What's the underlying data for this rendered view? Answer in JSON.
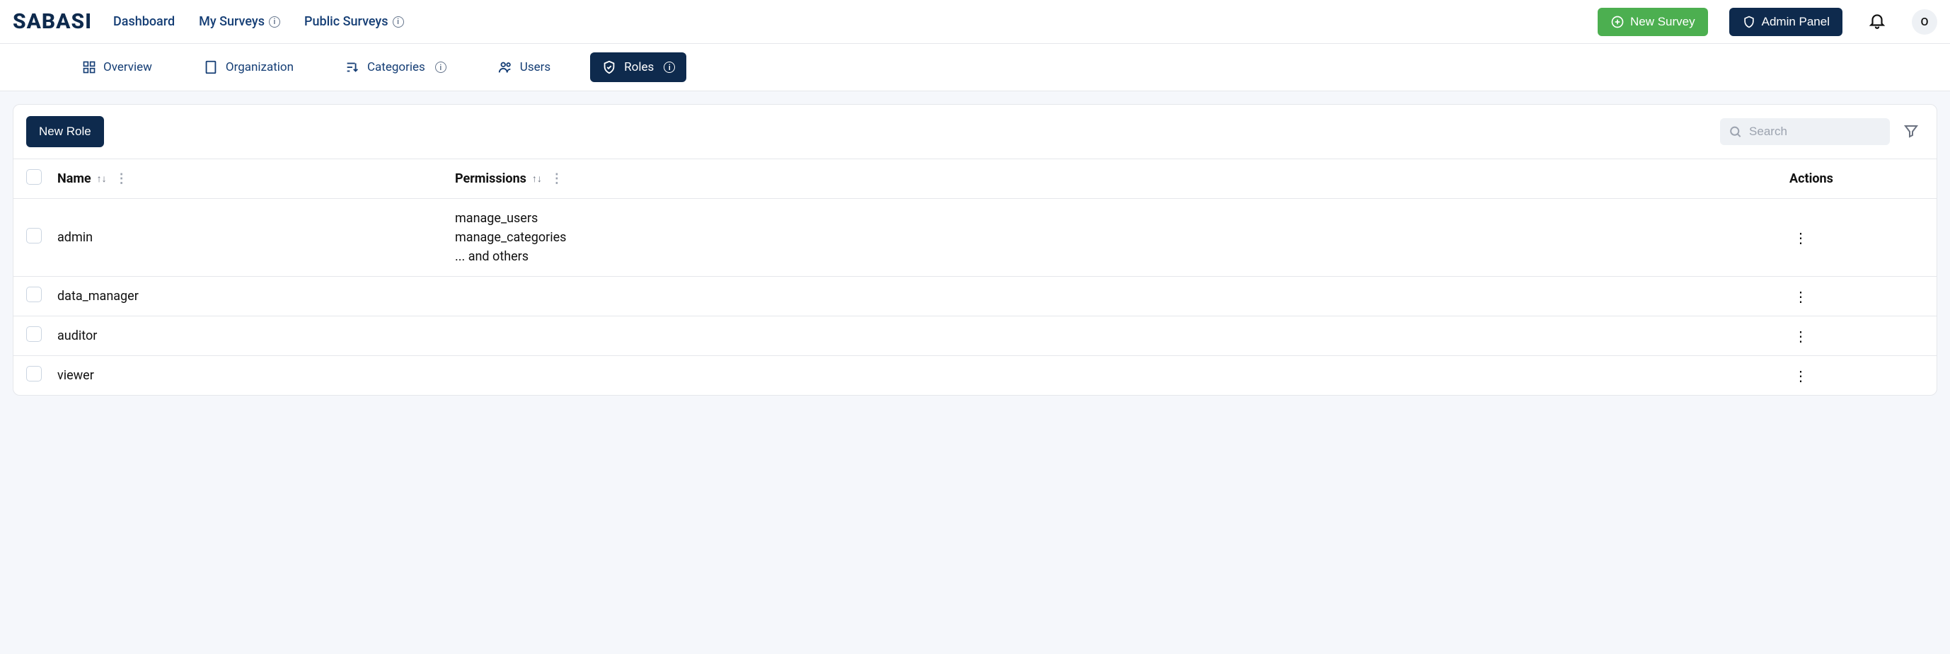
{
  "brand": "SABASI",
  "nav": {
    "dashboard": "Dashboard",
    "my_surveys": "My Surveys",
    "public_surveys": "Public Surveys"
  },
  "actions": {
    "new_survey": "New Survey",
    "admin_panel": "Admin Panel"
  },
  "avatar_initial": "O",
  "subtabs": {
    "overview": "Overview",
    "organization": "Organization",
    "categories": "Categories",
    "users": "Users",
    "roles": "Roles"
  },
  "panel": {
    "new_role": "New Role",
    "search_placeholder": "Search"
  },
  "table": {
    "headers": {
      "name": "Name",
      "permissions": "Permissions",
      "actions": "Actions"
    },
    "rows": [
      {
        "name": "admin",
        "permissions": [
          "manage_users",
          "manage_categories",
          "... and others"
        ]
      },
      {
        "name": "data_manager",
        "permissions": []
      },
      {
        "name": "auditor",
        "permissions": []
      },
      {
        "name": "viewer",
        "permissions": []
      }
    ]
  }
}
